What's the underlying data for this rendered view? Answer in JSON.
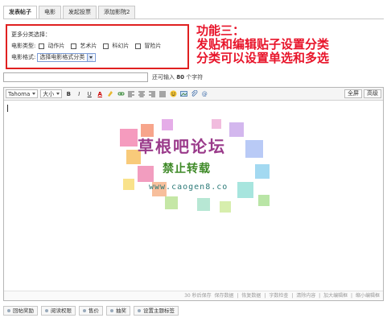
{
  "tabs": [
    {
      "label": "发表帖子",
      "active": true
    },
    {
      "label": "电影",
      "active": false
    },
    {
      "label": "发起投票",
      "active": false
    },
    {
      "label": "添加影院2",
      "active": false
    }
  ],
  "category_panel": {
    "heading": "更多分类选择：",
    "type_label": "电影类型:",
    "options": [
      "动作片",
      "艺术片",
      "科幻片",
      "冒险片"
    ],
    "format_label": "电影格式:",
    "format_select_value": "选择电影格式分类"
  },
  "annotation": {
    "line1": "功能三：",
    "line2": "发贴和编辑贴子设置分类",
    "line3": "分类可以设置单选和多选"
  },
  "title_counter": {
    "prefix": "还可输入",
    "count": "80",
    "suffix": "个字符"
  },
  "editor": {
    "font_name": "Tahoma",
    "font_size": "大小",
    "btn_bold": "B",
    "btn_italic": "I",
    "btn_underline": "U",
    "btn_color": "A",
    "fullscreen_label": "全屏",
    "advanced_label": "高级",
    "status_bar": [
      "30 秒后保存",
      "保存数据",
      "|",
      "恢复数据",
      "|",
      "字数检查",
      "|",
      "清除内容",
      "|",
      "加大编辑框",
      "|",
      "缩小编辑框"
    ]
  },
  "watermark": {
    "line1": "草根吧论坛",
    "line2": "禁止转载",
    "line3": "www.caogen8.co"
  },
  "bottom_buttons": [
    "回帖奖励",
    "阅读权限",
    "售价",
    "抽奖",
    "设置主题标签"
  ]
}
